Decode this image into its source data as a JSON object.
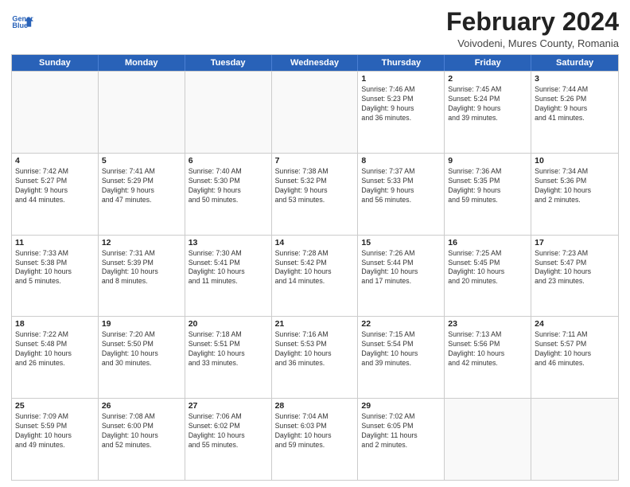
{
  "header": {
    "logo_line1": "General",
    "logo_line2": "Blue",
    "month": "February 2024",
    "location": "Voivodeni, Mures County, Romania"
  },
  "days": [
    "Sunday",
    "Monday",
    "Tuesday",
    "Wednesday",
    "Thursday",
    "Friday",
    "Saturday"
  ],
  "rows": [
    [
      {
        "day": "",
        "info": ""
      },
      {
        "day": "",
        "info": ""
      },
      {
        "day": "",
        "info": ""
      },
      {
        "day": "",
        "info": ""
      },
      {
        "day": "1",
        "info": "Sunrise: 7:46 AM\nSunset: 5:23 PM\nDaylight: 9 hours\nand 36 minutes."
      },
      {
        "day": "2",
        "info": "Sunrise: 7:45 AM\nSunset: 5:24 PM\nDaylight: 9 hours\nand 39 minutes."
      },
      {
        "day": "3",
        "info": "Sunrise: 7:44 AM\nSunset: 5:26 PM\nDaylight: 9 hours\nand 41 minutes."
      }
    ],
    [
      {
        "day": "4",
        "info": "Sunrise: 7:42 AM\nSunset: 5:27 PM\nDaylight: 9 hours\nand 44 minutes."
      },
      {
        "day": "5",
        "info": "Sunrise: 7:41 AM\nSunset: 5:29 PM\nDaylight: 9 hours\nand 47 minutes."
      },
      {
        "day": "6",
        "info": "Sunrise: 7:40 AM\nSunset: 5:30 PM\nDaylight: 9 hours\nand 50 minutes."
      },
      {
        "day": "7",
        "info": "Sunrise: 7:38 AM\nSunset: 5:32 PM\nDaylight: 9 hours\nand 53 minutes."
      },
      {
        "day": "8",
        "info": "Sunrise: 7:37 AM\nSunset: 5:33 PM\nDaylight: 9 hours\nand 56 minutes."
      },
      {
        "day": "9",
        "info": "Sunrise: 7:36 AM\nSunset: 5:35 PM\nDaylight: 9 hours\nand 59 minutes."
      },
      {
        "day": "10",
        "info": "Sunrise: 7:34 AM\nSunset: 5:36 PM\nDaylight: 10 hours\nand 2 minutes."
      }
    ],
    [
      {
        "day": "11",
        "info": "Sunrise: 7:33 AM\nSunset: 5:38 PM\nDaylight: 10 hours\nand 5 minutes."
      },
      {
        "day": "12",
        "info": "Sunrise: 7:31 AM\nSunset: 5:39 PM\nDaylight: 10 hours\nand 8 minutes."
      },
      {
        "day": "13",
        "info": "Sunrise: 7:30 AM\nSunset: 5:41 PM\nDaylight: 10 hours\nand 11 minutes."
      },
      {
        "day": "14",
        "info": "Sunrise: 7:28 AM\nSunset: 5:42 PM\nDaylight: 10 hours\nand 14 minutes."
      },
      {
        "day": "15",
        "info": "Sunrise: 7:26 AM\nSunset: 5:44 PM\nDaylight: 10 hours\nand 17 minutes."
      },
      {
        "day": "16",
        "info": "Sunrise: 7:25 AM\nSunset: 5:45 PM\nDaylight: 10 hours\nand 20 minutes."
      },
      {
        "day": "17",
        "info": "Sunrise: 7:23 AM\nSunset: 5:47 PM\nDaylight: 10 hours\nand 23 minutes."
      }
    ],
    [
      {
        "day": "18",
        "info": "Sunrise: 7:22 AM\nSunset: 5:48 PM\nDaylight: 10 hours\nand 26 minutes."
      },
      {
        "day": "19",
        "info": "Sunrise: 7:20 AM\nSunset: 5:50 PM\nDaylight: 10 hours\nand 30 minutes."
      },
      {
        "day": "20",
        "info": "Sunrise: 7:18 AM\nSunset: 5:51 PM\nDaylight: 10 hours\nand 33 minutes."
      },
      {
        "day": "21",
        "info": "Sunrise: 7:16 AM\nSunset: 5:53 PM\nDaylight: 10 hours\nand 36 minutes."
      },
      {
        "day": "22",
        "info": "Sunrise: 7:15 AM\nSunset: 5:54 PM\nDaylight: 10 hours\nand 39 minutes."
      },
      {
        "day": "23",
        "info": "Sunrise: 7:13 AM\nSunset: 5:56 PM\nDaylight: 10 hours\nand 42 minutes."
      },
      {
        "day": "24",
        "info": "Sunrise: 7:11 AM\nSunset: 5:57 PM\nDaylight: 10 hours\nand 46 minutes."
      }
    ],
    [
      {
        "day": "25",
        "info": "Sunrise: 7:09 AM\nSunset: 5:59 PM\nDaylight: 10 hours\nand 49 minutes."
      },
      {
        "day": "26",
        "info": "Sunrise: 7:08 AM\nSunset: 6:00 PM\nDaylight: 10 hours\nand 52 minutes."
      },
      {
        "day": "27",
        "info": "Sunrise: 7:06 AM\nSunset: 6:02 PM\nDaylight: 10 hours\nand 55 minutes."
      },
      {
        "day": "28",
        "info": "Sunrise: 7:04 AM\nSunset: 6:03 PM\nDaylight: 10 hours\nand 59 minutes."
      },
      {
        "day": "29",
        "info": "Sunrise: 7:02 AM\nSunset: 6:05 PM\nDaylight: 11 hours\nand 2 minutes."
      },
      {
        "day": "",
        "info": ""
      },
      {
        "day": "",
        "info": ""
      }
    ]
  ]
}
